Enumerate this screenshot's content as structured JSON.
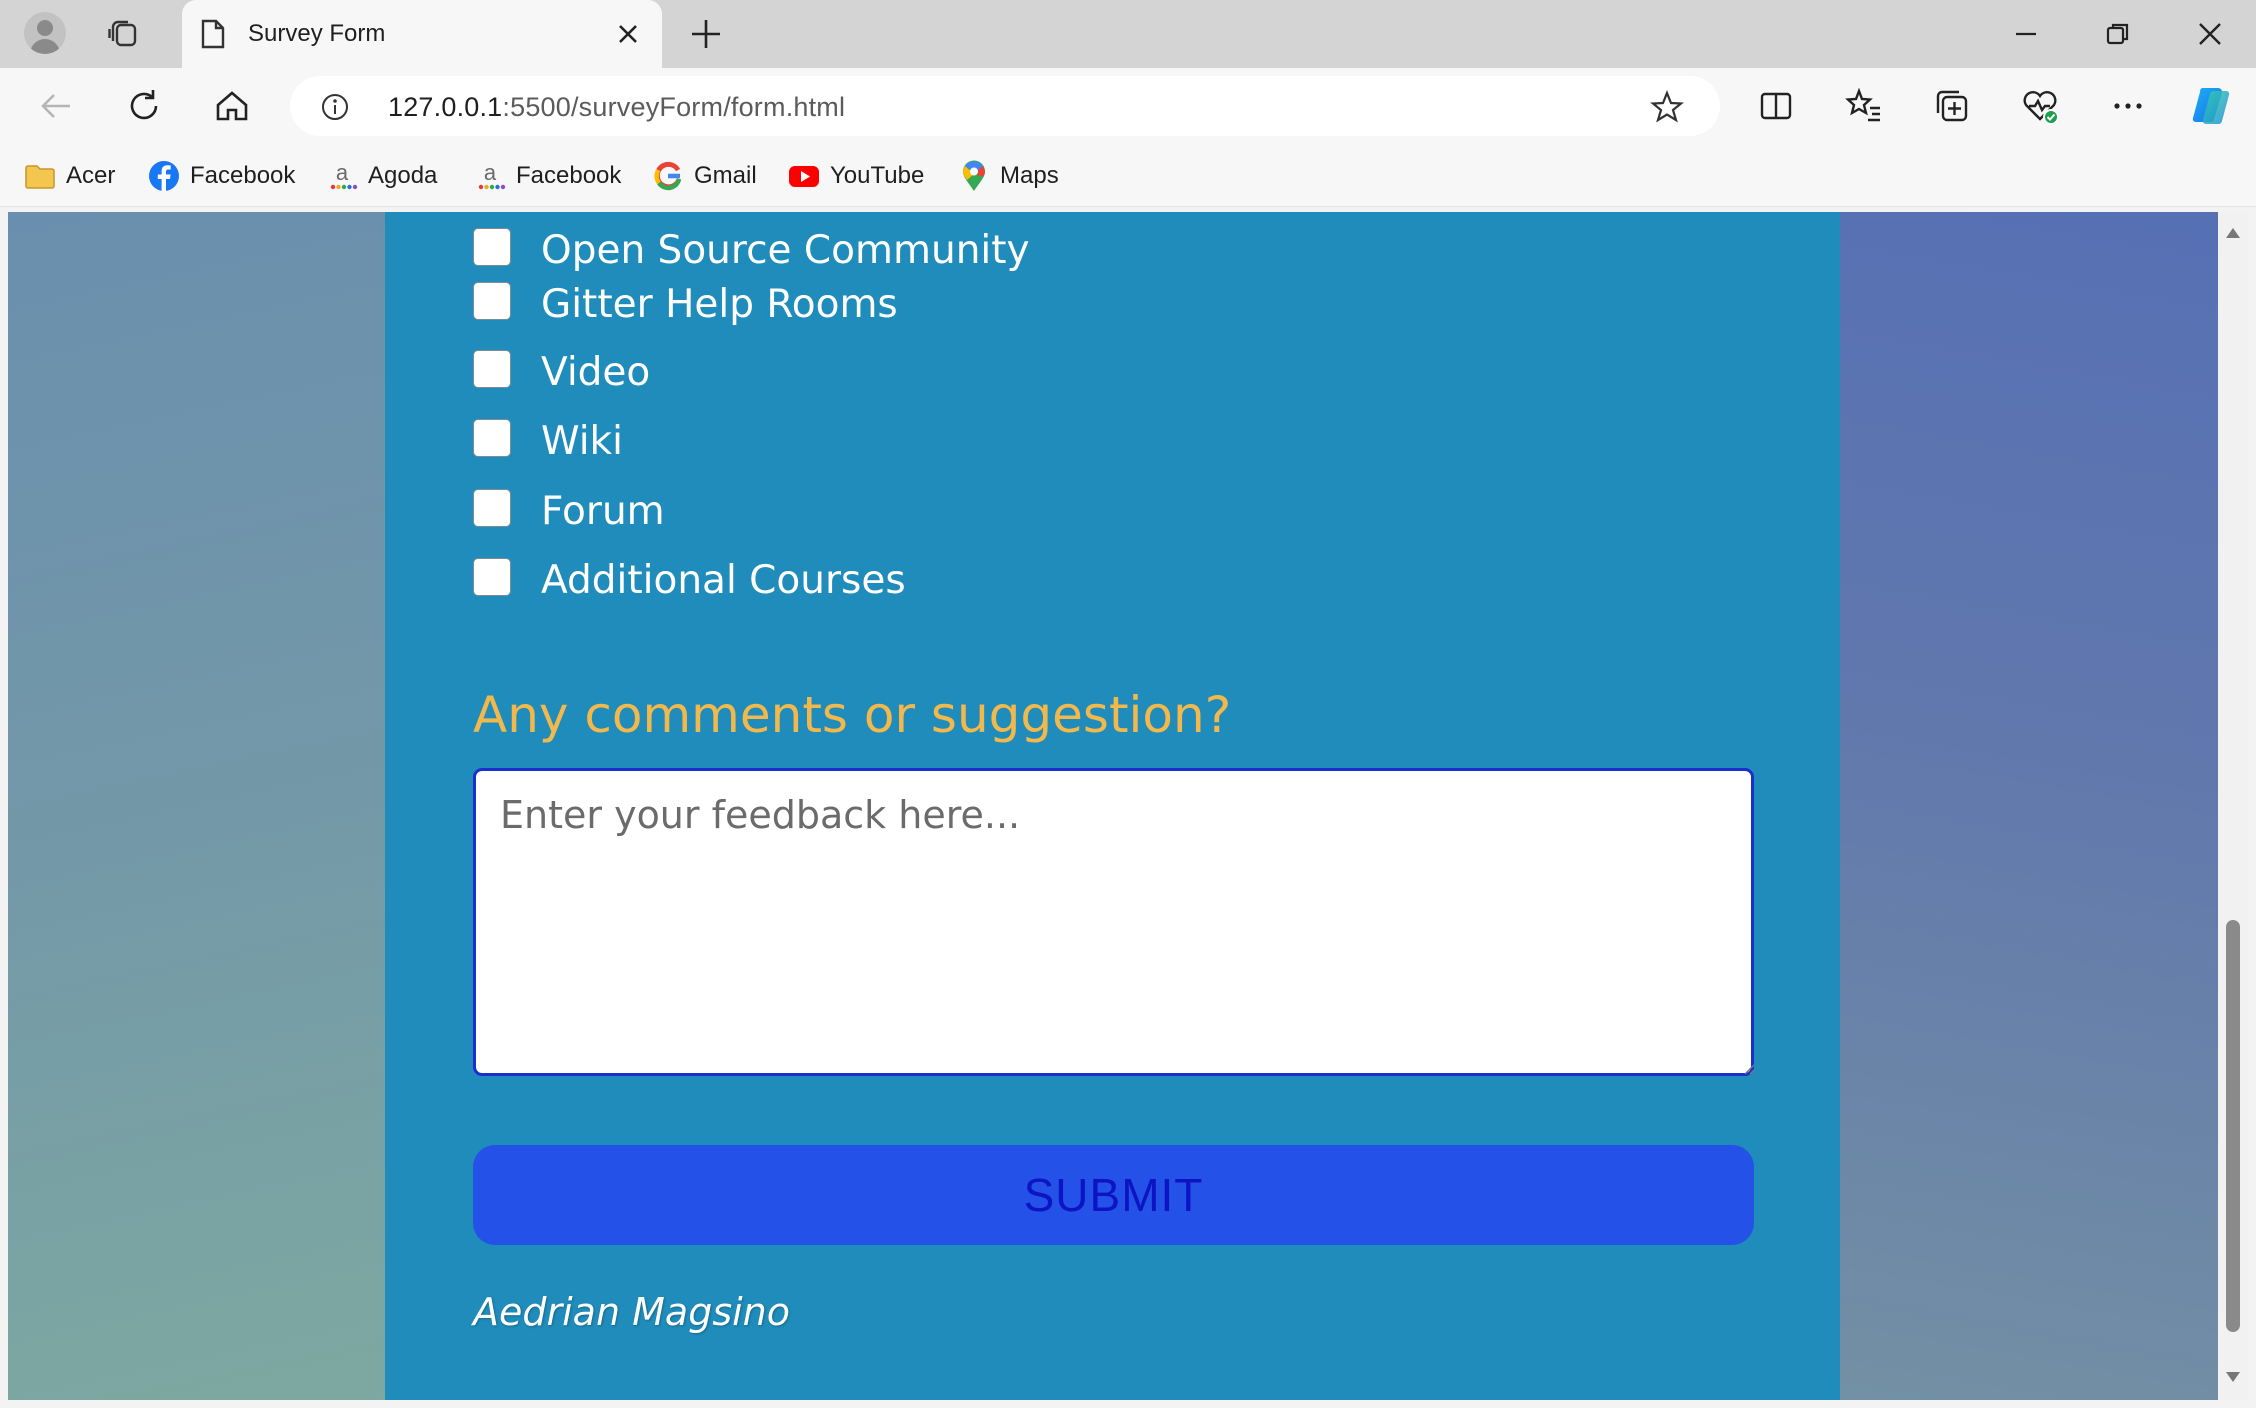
{
  "browser": {
    "tab_title": "Survey Form",
    "url_host": "127.0.0.1",
    "url_rest": ":5500/surveyForm/form.html",
    "bookmarks": [
      {
        "label": "Acer",
        "icon": "folder-icon"
      },
      {
        "label": "Facebook",
        "icon": "facebook-icon"
      },
      {
        "label": "Agoda",
        "icon": "agoda-icon"
      },
      {
        "label": "Facebook",
        "icon": "agoda-icon"
      },
      {
        "label": "Gmail",
        "icon": "google-icon"
      },
      {
        "label": "YouTube",
        "icon": "youtube-icon"
      },
      {
        "label": "Maps",
        "icon": "maps-icon"
      }
    ]
  },
  "form": {
    "options": [
      {
        "label": "Open Source Community",
        "checked": false
      },
      {
        "label": "Gitter Help Rooms",
        "checked": false
      },
      {
        "label": "Video",
        "checked": false
      },
      {
        "label": "Wiki",
        "checked": false
      },
      {
        "label": "Forum",
        "checked": false
      },
      {
        "label": "Additional Courses",
        "checked": false
      }
    ],
    "comments_title": "Any comments or suggestion?",
    "feedback_placeholder": "Enter your feedback here...",
    "submit_label": "SUBMIT",
    "author": "Aedrian Magsino"
  },
  "colors": {
    "panel": "#1f8cbb",
    "heading_accent": "#f2b84c",
    "submit_bg": "#2451e8",
    "submit_text": "#0d14c4"
  }
}
